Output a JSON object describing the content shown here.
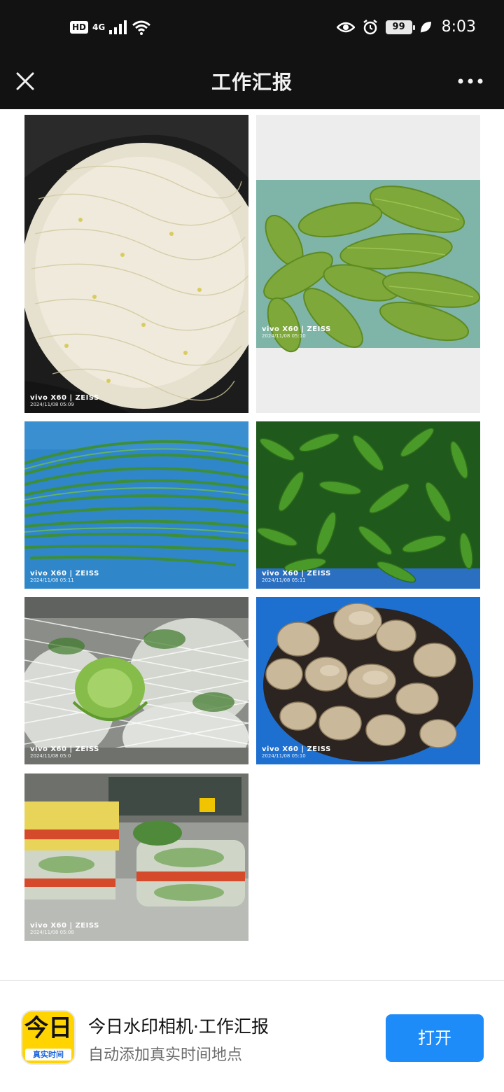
{
  "status_bar": {
    "hd": "HD",
    "network": "4G",
    "battery": "99",
    "time": "8:03",
    "icons": [
      "signal-icon",
      "wifi-icon",
      "eye-icon",
      "alarm-icon",
      "battery-icon",
      "leaf-icon"
    ]
  },
  "title_bar": {
    "title": "工作汇报",
    "close_icon": "close-icon",
    "more_icon": "more-dots-icon"
  },
  "photos": [
    {
      "subject": "bean sprouts",
      "brand": "vivo X60 | ZEISS",
      "stamp": "2024/11/08 05:09"
    },
    {
      "subject": "bitter melon",
      "brand": "vivo X60 | ZEISS",
      "stamp": "2024/11/08 05:10"
    },
    {
      "subject": "long beans",
      "brand": "vivo X60 | ZEISS",
      "stamp": "2024/11/08 05:11"
    },
    {
      "subject": "green chili peppers",
      "brand": "vivo X60 | ZEISS",
      "stamp": "2024/11/08 05:11"
    },
    {
      "subject": "cabbage",
      "brand": "vivo X60 | ZEISS",
      "stamp": "2024/11/08 05:0"
    },
    {
      "subject": "lotus root",
      "brand": "vivo X60 | ZEISS",
      "stamp": "2024/11/08 05:10"
    },
    {
      "subject": "packaged vegetables",
      "brand": "vivo X60 | ZEISS",
      "stamp": "2024/11/08 05:08"
    }
  ],
  "banner": {
    "app_icon_text": "今日",
    "app_icon_strip": "真实时间",
    "app_name": "今日水印相机·工作汇报",
    "app_desc": "自动添加真实时间地点",
    "open_label": "打开",
    "colors": {
      "accent": "#1d8cf8",
      "icon_bg": "#ffd400"
    }
  }
}
